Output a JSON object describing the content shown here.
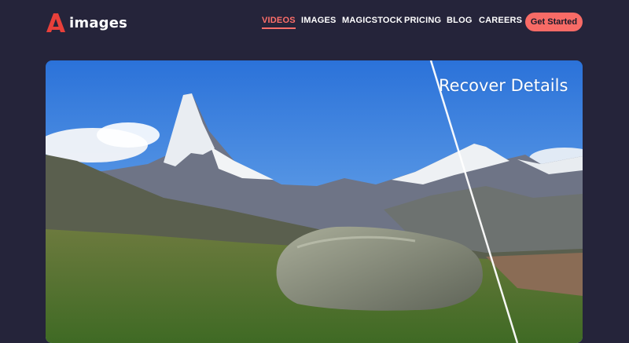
{
  "brand": {
    "name": "images",
    "logo_icon": "a-logo-icon",
    "accent": "#f0504a"
  },
  "nav": {
    "items": [
      {
        "label": "VIDEOS",
        "active": true
      },
      {
        "label": "IMAGES",
        "active": false
      },
      {
        "label": "MAGICSTOCK",
        "active": false
      },
      {
        "label": "PRICING",
        "active": false
      },
      {
        "label": "BLOG",
        "active": false
      },
      {
        "label": "CAREERS",
        "active": false
      }
    ],
    "cta_label": "Get Started",
    "cta_color": "#f86b66"
  },
  "hero": {
    "label": "Recover Details",
    "image_subject": "mountain-landscape-comparison"
  }
}
